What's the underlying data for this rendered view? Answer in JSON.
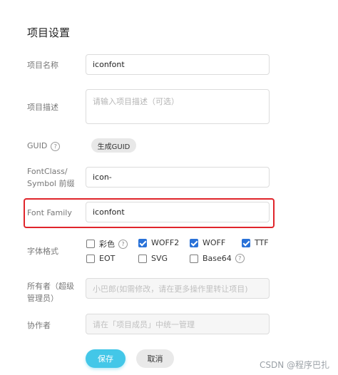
{
  "page": {
    "title": "项目设置"
  },
  "form": {
    "name": {
      "label": "项目名称",
      "value": "iconfont"
    },
    "description": {
      "label": "项目描述",
      "placeholder": "请输入项目描述（可选）"
    },
    "guid": {
      "label": "GUID",
      "help": "?",
      "button": "生成GUID"
    },
    "fontclass": {
      "label_line1": "FontClass/",
      "label_line2": "Symbol 前缀",
      "value": "icon-"
    },
    "fontfamily": {
      "label": "Font Family",
      "value": "iconfont"
    },
    "formats": {
      "label": "字体格式",
      "options": [
        {
          "label": "彩色",
          "checked": false,
          "help": "?"
        },
        {
          "label": "WOFF2",
          "checked": true
        },
        {
          "label": "WOFF",
          "checked": true
        },
        {
          "label": "TTF",
          "checked": true
        },
        {
          "label": "EOT",
          "checked": false
        },
        {
          "label": "SVG",
          "checked": false
        },
        {
          "label": "Base64",
          "checked": false,
          "help": "?"
        }
      ]
    },
    "owner": {
      "label_line1": "所有者（超级",
      "label_line2": "管理员）",
      "placeholder": "小巴郎(如需修改，请在更多操作里转让项目)"
    },
    "collaborators": {
      "label": "协作者",
      "placeholder": "请在「项目成员」中统一管理"
    }
  },
  "actions": {
    "save": "保存",
    "cancel": "取消"
  },
  "watermark": "CSDN @程序巴扎",
  "colors": {
    "accent": "#43c7e8",
    "checkbox": "#2a72d8",
    "highlight": "#e0252b"
  }
}
